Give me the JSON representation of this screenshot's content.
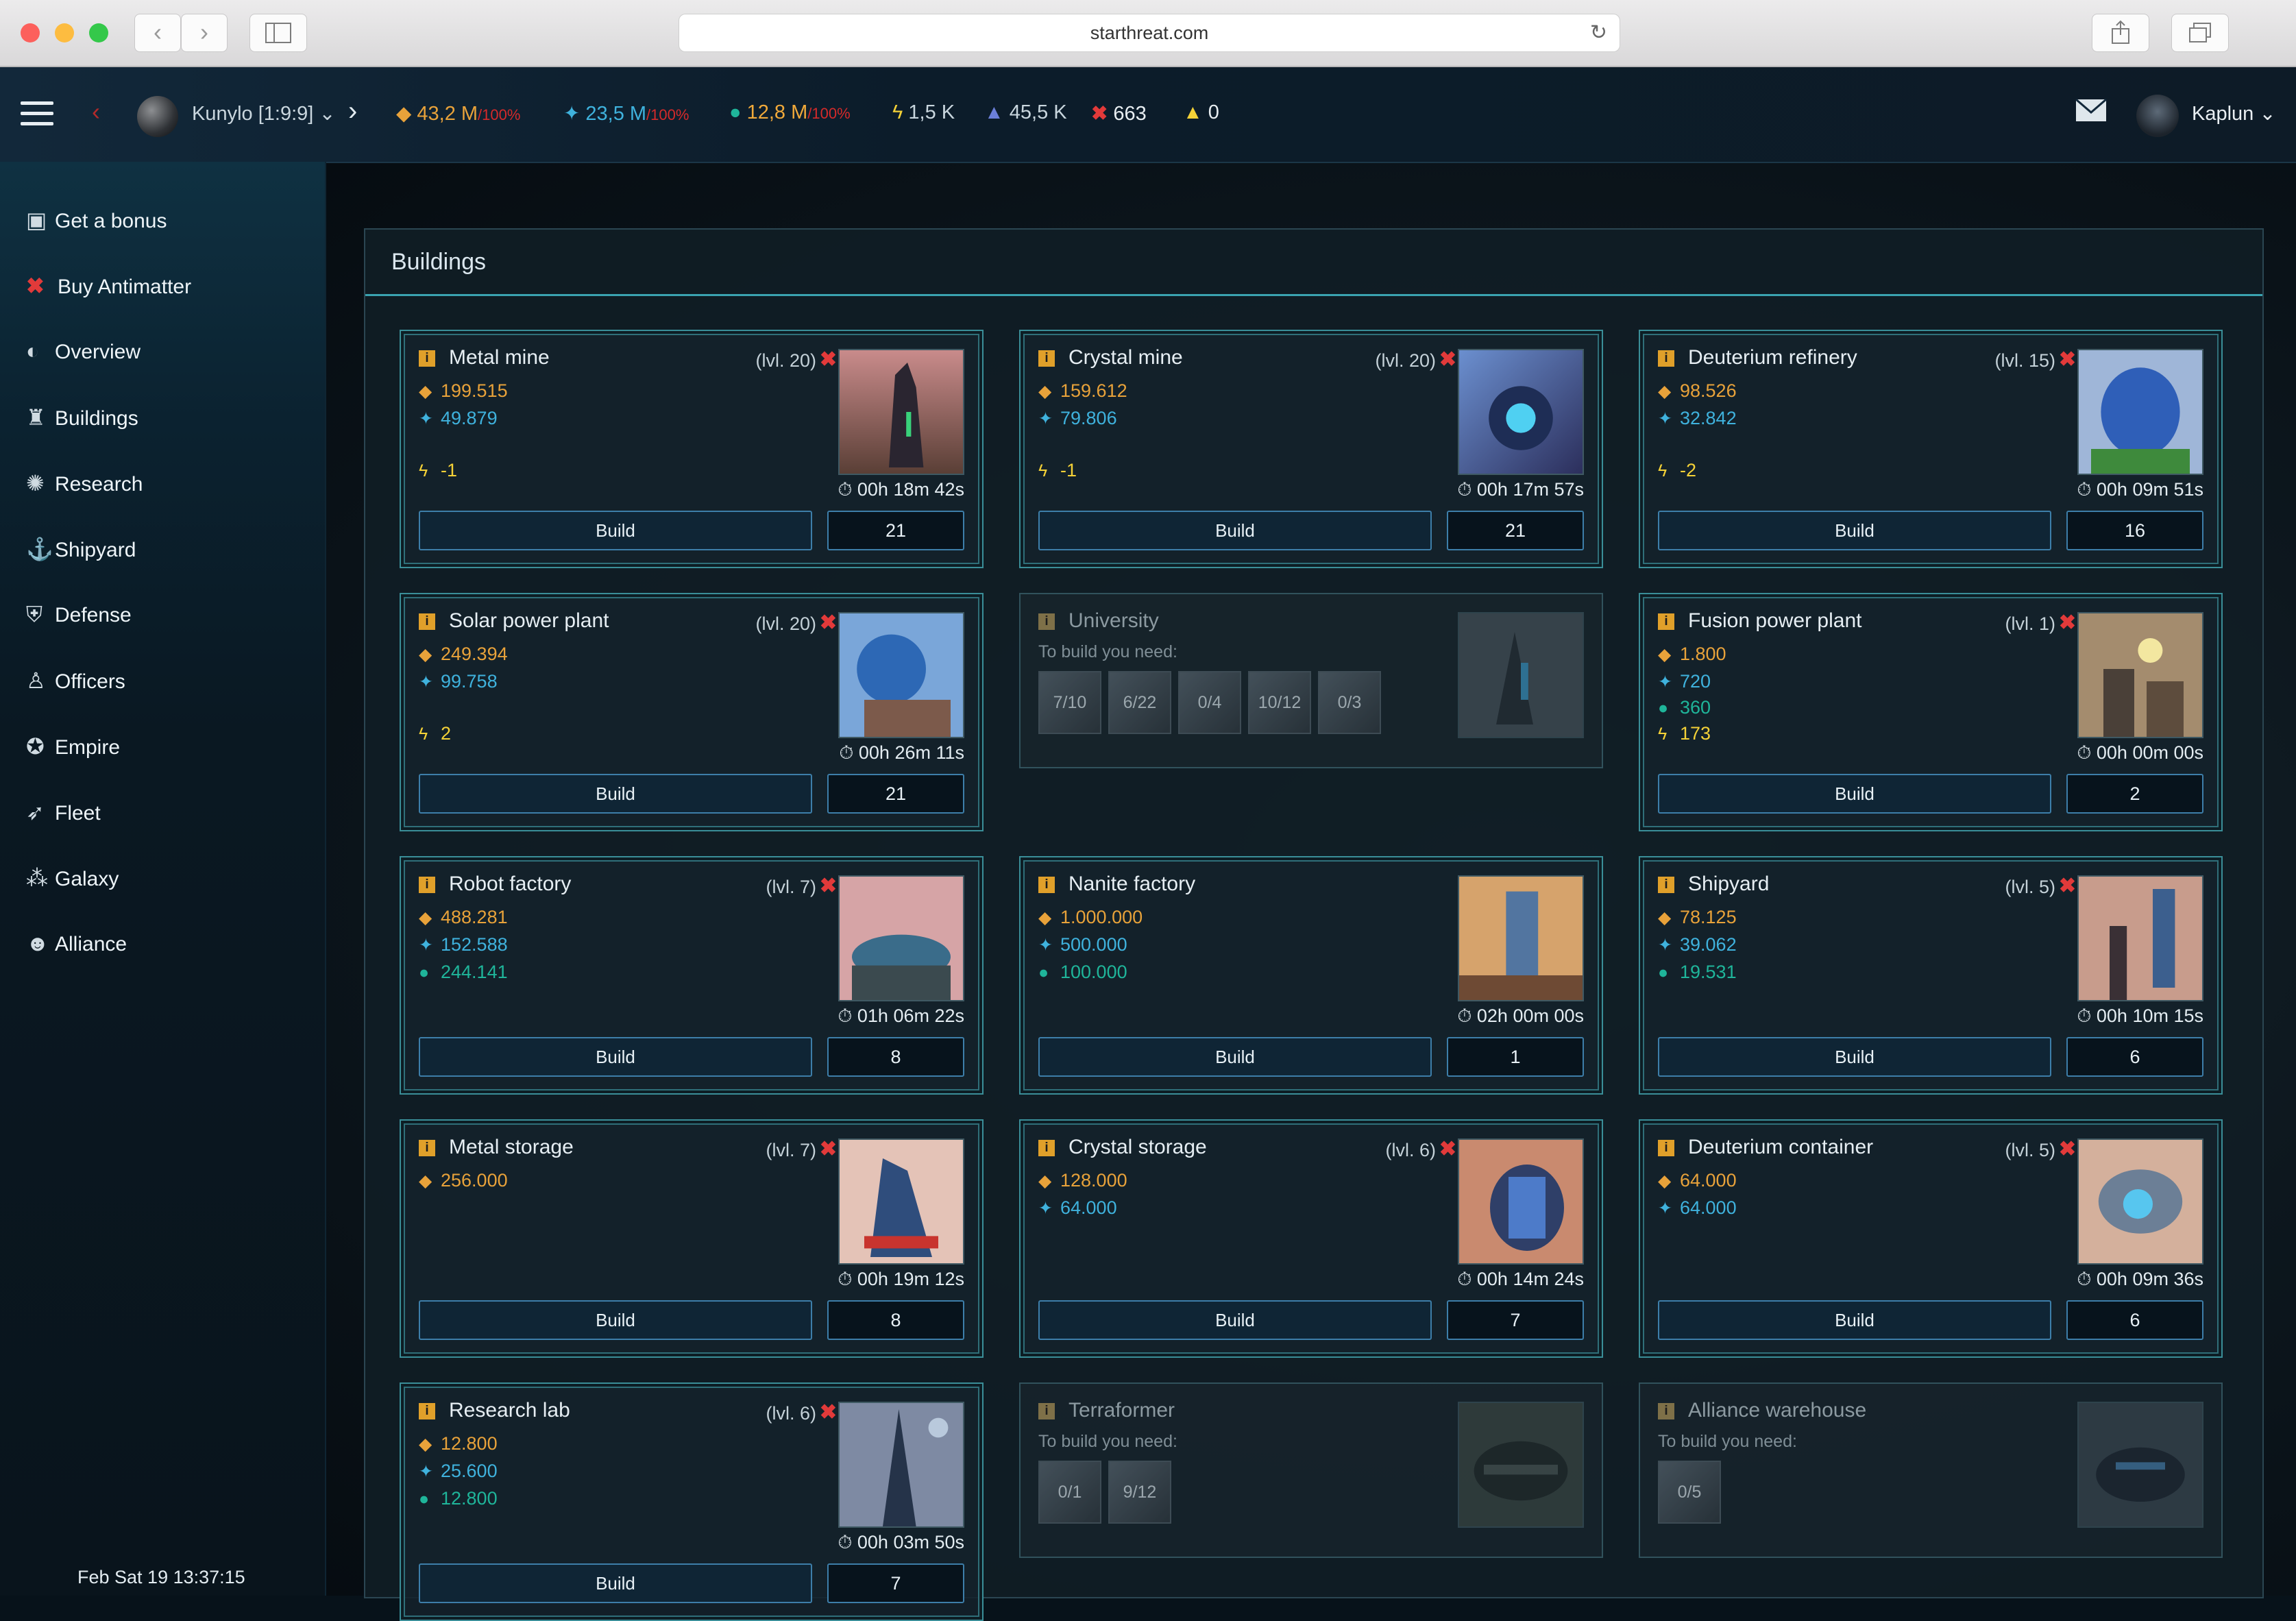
{
  "browser": {
    "url": "starthreat.com"
  },
  "topbar": {
    "planet_name": "Kunylo [1:9:9]",
    "metal": "43,2 M",
    "metal_pct": "/100%",
    "crystal": "23,5 M",
    "crystal_pct": "/100%",
    "deuterium": "12,8 M",
    "deuterium_pct": "/100%",
    "energy": "1,5 K",
    "fleet_points": "45,5 K",
    "antimatter": "663",
    "alerts": "0",
    "username": "Kaplun"
  },
  "sidebar": {
    "items": [
      {
        "label": "Get a bonus",
        "icon": "gift-icon"
      },
      {
        "label": "Buy Antimatter",
        "icon": "antimatter-icon"
      },
      {
        "label": "Overview",
        "icon": "globe-icon"
      },
      {
        "label": "Buildings",
        "icon": "building-icon"
      },
      {
        "label": "Research",
        "icon": "research-icon"
      },
      {
        "label": "Shipyard",
        "icon": "shipyard-icon"
      },
      {
        "label": "Defense",
        "icon": "defense-icon"
      },
      {
        "label": "Officers",
        "icon": "officers-icon"
      },
      {
        "label": "Empire",
        "icon": "empire-icon"
      },
      {
        "label": "Fleet",
        "icon": "rocket-icon"
      },
      {
        "label": "Galaxy",
        "icon": "galaxy-icon"
      },
      {
        "label": "Alliance",
        "icon": "alliance-icon"
      }
    ],
    "clock": "Feb Sat 19 13:37:15"
  },
  "panel": {
    "title": "Buildings"
  },
  "buildings": [
    {
      "name": "Metal mine",
      "level": "(lvl. 20)",
      "metal": "199.515",
      "crystal": "49.879",
      "energy": "-1",
      "time": "00h 18m 42s",
      "build": "Build",
      "qty": "21"
    },
    {
      "name": "Crystal mine",
      "level": "(lvl. 20)",
      "metal": "159.612",
      "crystal": "79.806",
      "energy": "-1",
      "time": "00h 17m 57s",
      "build": "Build",
      "qty": "21"
    },
    {
      "name": "Deuterium refinery",
      "level": "(lvl. 15)",
      "metal": "98.526",
      "crystal": "32.842",
      "energy": "-2",
      "time": "00h 09m 51s",
      "build": "Build",
      "qty": "16"
    },
    {
      "name": "Solar power plant",
      "level": "(lvl. 20)",
      "metal": "249.394",
      "crystal": "99.758",
      "energy": "2",
      "time": "00h 26m 11s",
      "build": "Build",
      "qty": "21"
    },
    {
      "name": "University",
      "need": "To build you need:",
      "reqs": [
        "7/10",
        "6/22",
        "0/4",
        "10/12",
        "0/3"
      ]
    },
    {
      "name": "Fusion power plant",
      "level": "(lvl. 1)",
      "metal": "1.800",
      "crystal": "720",
      "deuterium": "360",
      "energy": "173",
      "time": "00h 00m 00s",
      "build": "Build",
      "qty": "2"
    },
    {
      "name": "Robot factory",
      "level": "(lvl. 7)",
      "metal": "488.281",
      "crystal": "152.588",
      "deuterium": "244.141",
      "time": "01h 06m 22s",
      "build": "Build",
      "qty": "8"
    },
    {
      "name": "Nanite factory",
      "metal": "1.000.000",
      "crystal": "500.000",
      "deuterium": "100.000",
      "time": "02h 00m 00s",
      "build": "Build",
      "qty": "1"
    },
    {
      "name": "Shipyard",
      "level": "(lvl. 5)",
      "metal": "78.125",
      "crystal": "39.062",
      "deuterium": "19.531",
      "time": "00h 10m 15s",
      "build": "Build",
      "qty": "6"
    },
    {
      "name": "Metal storage",
      "level": "(lvl. 7)",
      "metal": "256.000",
      "time": "00h 19m 12s",
      "build": "Build",
      "qty": "8"
    },
    {
      "name": "Crystal storage",
      "level": "(lvl. 6)",
      "metal": "128.000",
      "crystal": "64.000",
      "time": "00h 14m 24s",
      "build": "Build",
      "qty": "7"
    },
    {
      "name": "Deuterium container",
      "level": "(lvl. 5)",
      "metal": "64.000",
      "crystal": "64.000",
      "time": "00h 09m 36s",
      "build": "Build",
      "qty": "6"
    },
    {
      "name": "Research lab",
      "level": "(lvl. 6)",
      "metal": "12.800",
      "crystal": "25.600",
      "deuterium": "12.800",
      "time": "00h 03m 50s",
      "build": "Build",
      "qty": "7"
    },
    {
      "name": "Terraformer",
      "need": "To build you need:",
      "reqs": [
        "0/1",
        "9/12"
      ]
    },
    {
      "name": "Alliance warehouse",
      "need": "To build you need:",
      "reqs": [
        "0/5"
      ]
    }
  ]
}
